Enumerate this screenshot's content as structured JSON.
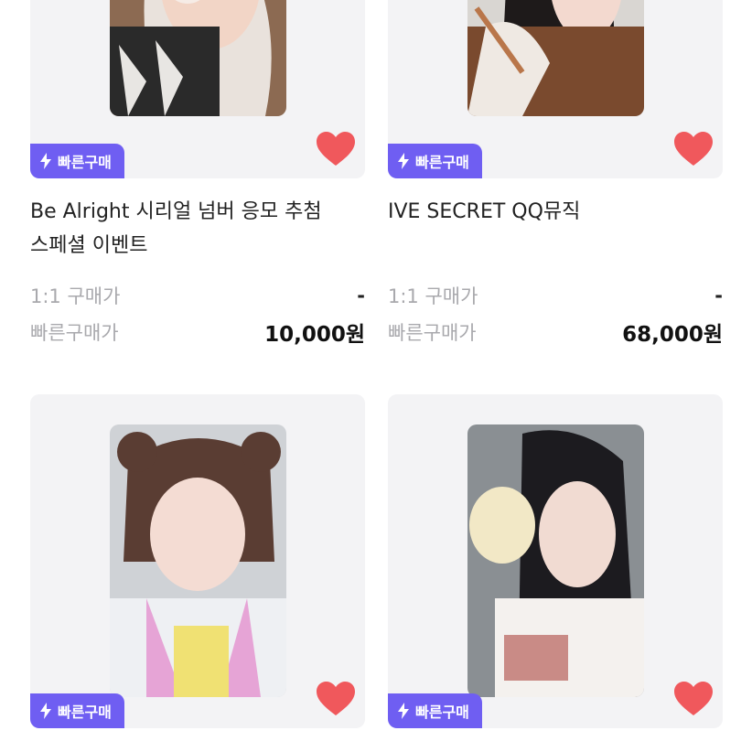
{
  "products": [
    {
      "badge": "빠른구매",
      "title_lines": [
        "Be Alright 시리얼 넘버 응모 추첨",
        "스페셜 이벤트"
      ],
      "price_label_1": "1:1 구매가",
      "price_value_1": "-",
      "price_label_2": "빠른구매가",
      "price_value_2": "10,000원"
    },
    {
      "badge": "빠른구매",
      "title_lines": [
        "IVE SECRET QQ뮤직",
        ""
      ],
      "price_label_1": "1:1 구매가",
      "price_value_1": "-",
      "price_label_2": "빠른구매가",
      "price_value_2": "68,000원"
    },
    {
      "badge": "빠른구매"
    },
    {
      "badge": "빠른구매"
    }
  ],
  "colors": {
    "badge_bg": "#6f5ef2",
    "heart": "#f0585c",
    "card_bg": "#f3f3f5"
  },
  "icons": {
    "badge_icon": "lightning-bolt-icon",
    "favorite_icon": "heart-icon"
  }
}
